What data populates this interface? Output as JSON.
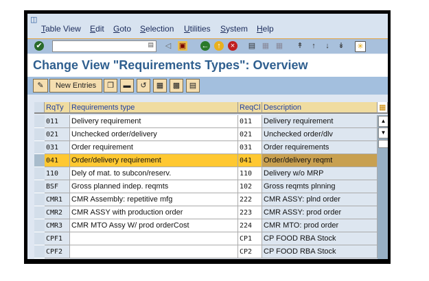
{
  "menubar": {
    "items": [
      "Table View",
      "Edit",
      "Goto",
      "Selection",
      "Utilities",
      "System",
      "Help"
    ]
  },
  "command_field": {
    "value": ""
  },
  "title": "Change View \"Requirements Types\": Overview",
  "app_toolbar": {
    "new_entries": "New Entries"
  },
  "table": {
    "headers": [
      "RqTy",
      "Requirements type",
      "ReqCl",
      "Description"
    ],
    "selected_row": 3,
    "rows": [
      [
        "011",
        "Delivery requirement",
        "011",
        "Delivery requirement"
      ],
      [
        "021",
        "Unchecked order/delivery",
        "021",
        "Unchecked order/dlv"
      ],
      [
        "031",
        "Order requirement",
        "031",
        "Order requirements"
      ],
      [
        "041",
        "Order/delivery requirement",
        "041",
        "Order/delivery reqmt"
      ],
      [
        "110",
        "Dely of mat. to subcon/reserv.",
        "110",
        "Delivery w/o MRP"
      ],
      [
        "BSF",
        "Gross planned indep. reqmts",
        "102",
        "Gross reqmts plnning"
      ],
      [
        "CMR1",
        "CMR Assembly: repetitive mfg",
        "222",
        "CMR ASSY: plnd order"
      ],
      [
        "CMR2",
        "CMR ASSY with production order",
        "223",
        "CMR ASSY: prod order"
      ],
      [
        "CMR3",
        "CMR MTO Assy W/ prod orderCost",
        "224",
        "CMR MTO: prod order"
      ],
      [
        "CPF1",
        "",
        "CP1",
        "CP FOOD RBA Stock"
      ],
      [
        "CPF2",
        "",
        "CP2",
        "CP FOOD RBA Stock"
      ]
    ]
  },
  "colors": {
    "title": "#2f5f8f",
    "selected_row": "#ffc832",
    "selected_desc": "#c8a050",
    "desc_bg": "#dde6f0"
  }
}
